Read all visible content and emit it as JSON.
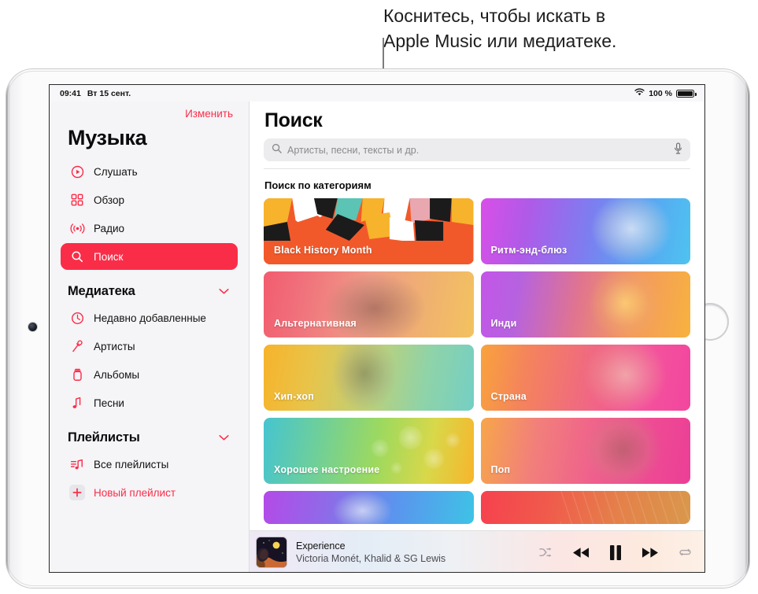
{
  "callout": {
    "text": "Коснитесь, чтобы искать в\nApple Music или медиатеке."
  },
  "status_bar": {
    "time": "09:41",
    "date": "Вт 15 сент.",
    "wifi_icon": "wifi-icon",
    "battery_percent": "100 %",
    "battery_icon": "battery-full-icon"
  },
  "sidebar": {
    "edit_label": "Изменить",
    "title": "Музыка",
    "nav_items": [
      {
        "label": "Слушать",
        "icon": "listen-now-icon",
        "selected": false
      },
      {
        "label": "Обзор",
        "icon": "browse-grid-icon",
        "selected": false
      },
      {
        "label": "Радио",
        "icon": "radio-broadcast-icon",
        "selected": false
      },
      {
        "label": "Поиск",
        "icon": "search-icon",
        "selected": true
      }
    ],
    "library": {
      "title": "Медиатека",
      "chevron_icon": "chevron-down-icon",
      "items": [
        {
          "label": "Недавно добавленные",
          "icon": "clock-icon"
        },
        {
          "label": "Артисты",
          "icon": "microphone-icon"
        },
        {
          "label": "Альбомы",
          "icon": "album-icon"
        },
        {
          "label": "Песни",
          "icon": "music-note-icon"
        }
      ]
    },
    "playlists": {
      "title": "Плейлисты",
      "chevron_icon": "chevron-down-icon",
      "items": [
        {
          "label": "Все плейлисты",
          "icon": "playlist-icon",
          "accent": false
        },
        {
          "label": "Новый плейлист",
          "icon": "plus-icon",
          "accent": true
        }
      ]
    }
  },
  "main": {
    "title": "Поиск",
    "search": {
      "placeholder": "Артисты, песни, тексты и др.",
      "value": "",
      "search_icon": "search-icon",
      "mic_icon": "microphone-icon"
    },
    "categories_heading": "Поиск по категориям",
    "tiles": [
      {
        "label": "Black History Month",
        "style": "bhm"
      },
      {
        "label": "Ритм-энд-блюз",
        "style": "rnb"
      },
      {
        "label": "Альтернативная",
        "style": "alt"
      },
      {
        "label": "Инди",
        "style": "indie"
      },
      {
        "label": "Хип-хоп",
        "style": "hiphop"
      },
      {
        "label": "Страна",
        "style": "country"
      },
      {
        "label": "Хорошее настроение",
        "style": "feelgood"
      },
      {
        "label": "Поп",
        "style": "pop"
      },
      {
        "label": "",
        "style": "partial-left"
      },
      {
        "label": "",
        "style": "partial-right"
      }
    ]
  },
  "player": {
    "track_title": "Experience",
    "track_artist": "Victoria Monét, Khalid & SG Lewis",
    "album_art": "album-artwork",
    "controls": [
      {
        "name": "shuffle-button",
        "icon": "shuffle-icon",
        "active": false
      },
      {
        "name": "previous-button",
        "icon": "rewind-icon",
        "active": true
      },
      {
        "name": "play-pause-button",
        "icon": "pause-icon",
        "active": true
      },
      {
        "name": "next-button",
        "icon": "fast-forward-icon",
        "active": true
      },
      {
        "name": "repeat-button",
        "icon": "repeat-icon",
        "active": false
      }
    ]
  },
  "colors": {
    "accent_red": "#FA2D48",
    "sidebar_bg": "#F5F4F7",
    "search_field_bg": "#ECECEE"
  }
}
